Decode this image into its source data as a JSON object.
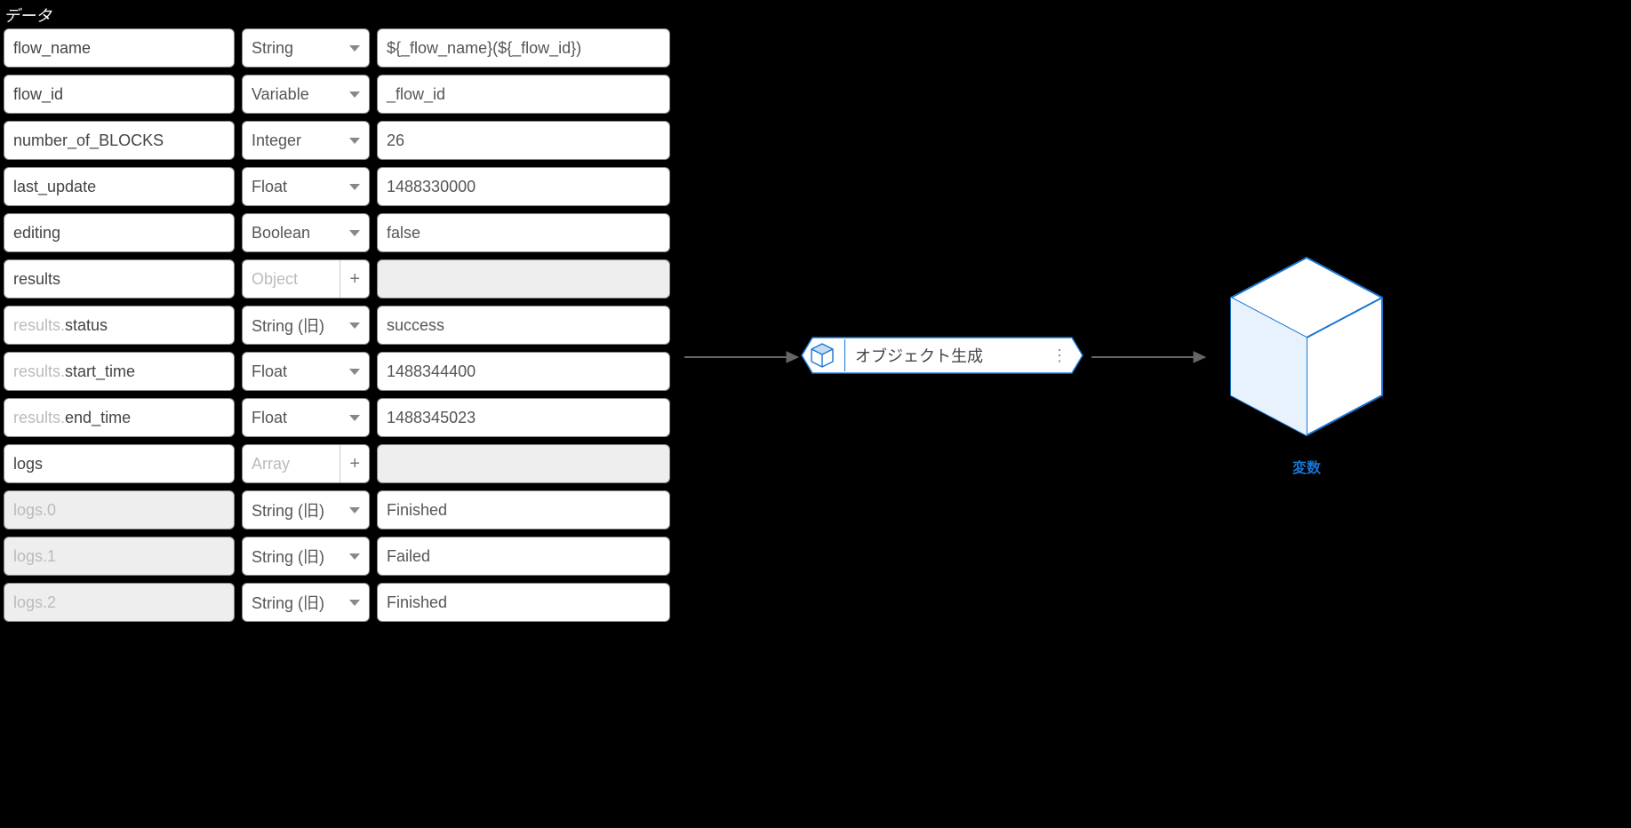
{
  "panel": {
    "title": "データ"
  },
  "rows": [
    {
      "keyPrefix": "",
      "keyName": "flow_name",
      "keyDim": false,
      "type": "String",
      "typeDim": false,
      "typeBtn": "caret",
      "value": "${_flow_name}(${_flow_id})",
      "valDim": false
    },
    {
      "keyPrefix": "",
      "keyName": "flow_id",
      "keyDim": false,
      "type": "Variable",
      "typeDim": false,
      "typeBtn": "caret",
      "value": "_flow_id",
      "valDim": false
    },
    {
      "keyPrefix": "",
      "keyName": "number_of_BLOCKS",
      "keyDim": false,
      "type": "Integer",
      "typeDim": false,
      "typeBtn": "caret",
      "value": "26",
      "valDim": false
    },
    {
      "keyPrefix": "",
      "keyName": "last_update",
      "keyDim": false,
      "type": "Float",
      "typeDim": false,
      "typeBtn": "caret",
      "value": "1488330000",
      "valDim": false
    },
    {
      "keyPrefix": "",
      "keyName": "editing",
      "keyDim": false,
      "type": "Boolean",
      "typeDim": false,
      "typeBtn": "caret",
      "value": "false",
      "valDim": false
    },
    {
      "keyPrefix": "",
      "keyName": "results",
      "keyDim": false,
      "type": "Object",
      "typeDim": true,
      "typeBtn": "plus",
      "value": "",
      "valDim": true
    },
    {
      "keyPrefix": "results.",
      "keyName": "status",
      "keyDim": false,
      "type": "String (旧)",
      "typeDim": false,
      "typeBtn": "caret",
      "value": "success",
      "valDim": false
    },
    {
      "keyPrefix": "results.",
      "keyName": "start_time",
      "keyDim": false,
      "type": "Float",
      "typeDim": false,
      "typeBtn": "caret",
      "value": "1488344400",
      "valDim": false
    },
    {
      "keyPrefix": "results.",
      "keyName": "end_time",
      "keyDim": false,
      "type": "Float",
      "typeDim": false,
      "typeBtn": "caret",
      "value": "1488345023",
      "valDim": false
    },
    {
      "keyPrefix": "",
      "keyName": "logs",
      "keyDim": false,
      "type": "Array",
      "typeDim": true,
      "typeBtn": "plus",
      "value": "",
      "valDim": true
    },
    {
      "keyPrefix": "",
      "keyName": "logs.0",
      "keyDim": true,
      "type": "String (旧)",
      "typeDim": false,
      "typeBtn": "caret",
      "value": "Finished",
      "valDim": false
    },
    {
      "keyPrefix": "",
      "keyName": "logs.1",
      "keyDim": true,
      "type": "String (旧)",
      "typeDim": false,
      "typeBtn": "caret",
      "value": "Failed",
      "valDim": false
    },
    {
      "keyPrefix": "",
      "keyName": "logs.2",
      "keyDim": true,
      "type": "String (旧)",
      "typeDim": false,
      "typeBtn": "caret",
      "value": "Finished",
      "valDim": false
    }
  ],
  "node": {
    "label": "オブジェクト生成"
  },
  "output": {
    "label": "変数"
  }
}
